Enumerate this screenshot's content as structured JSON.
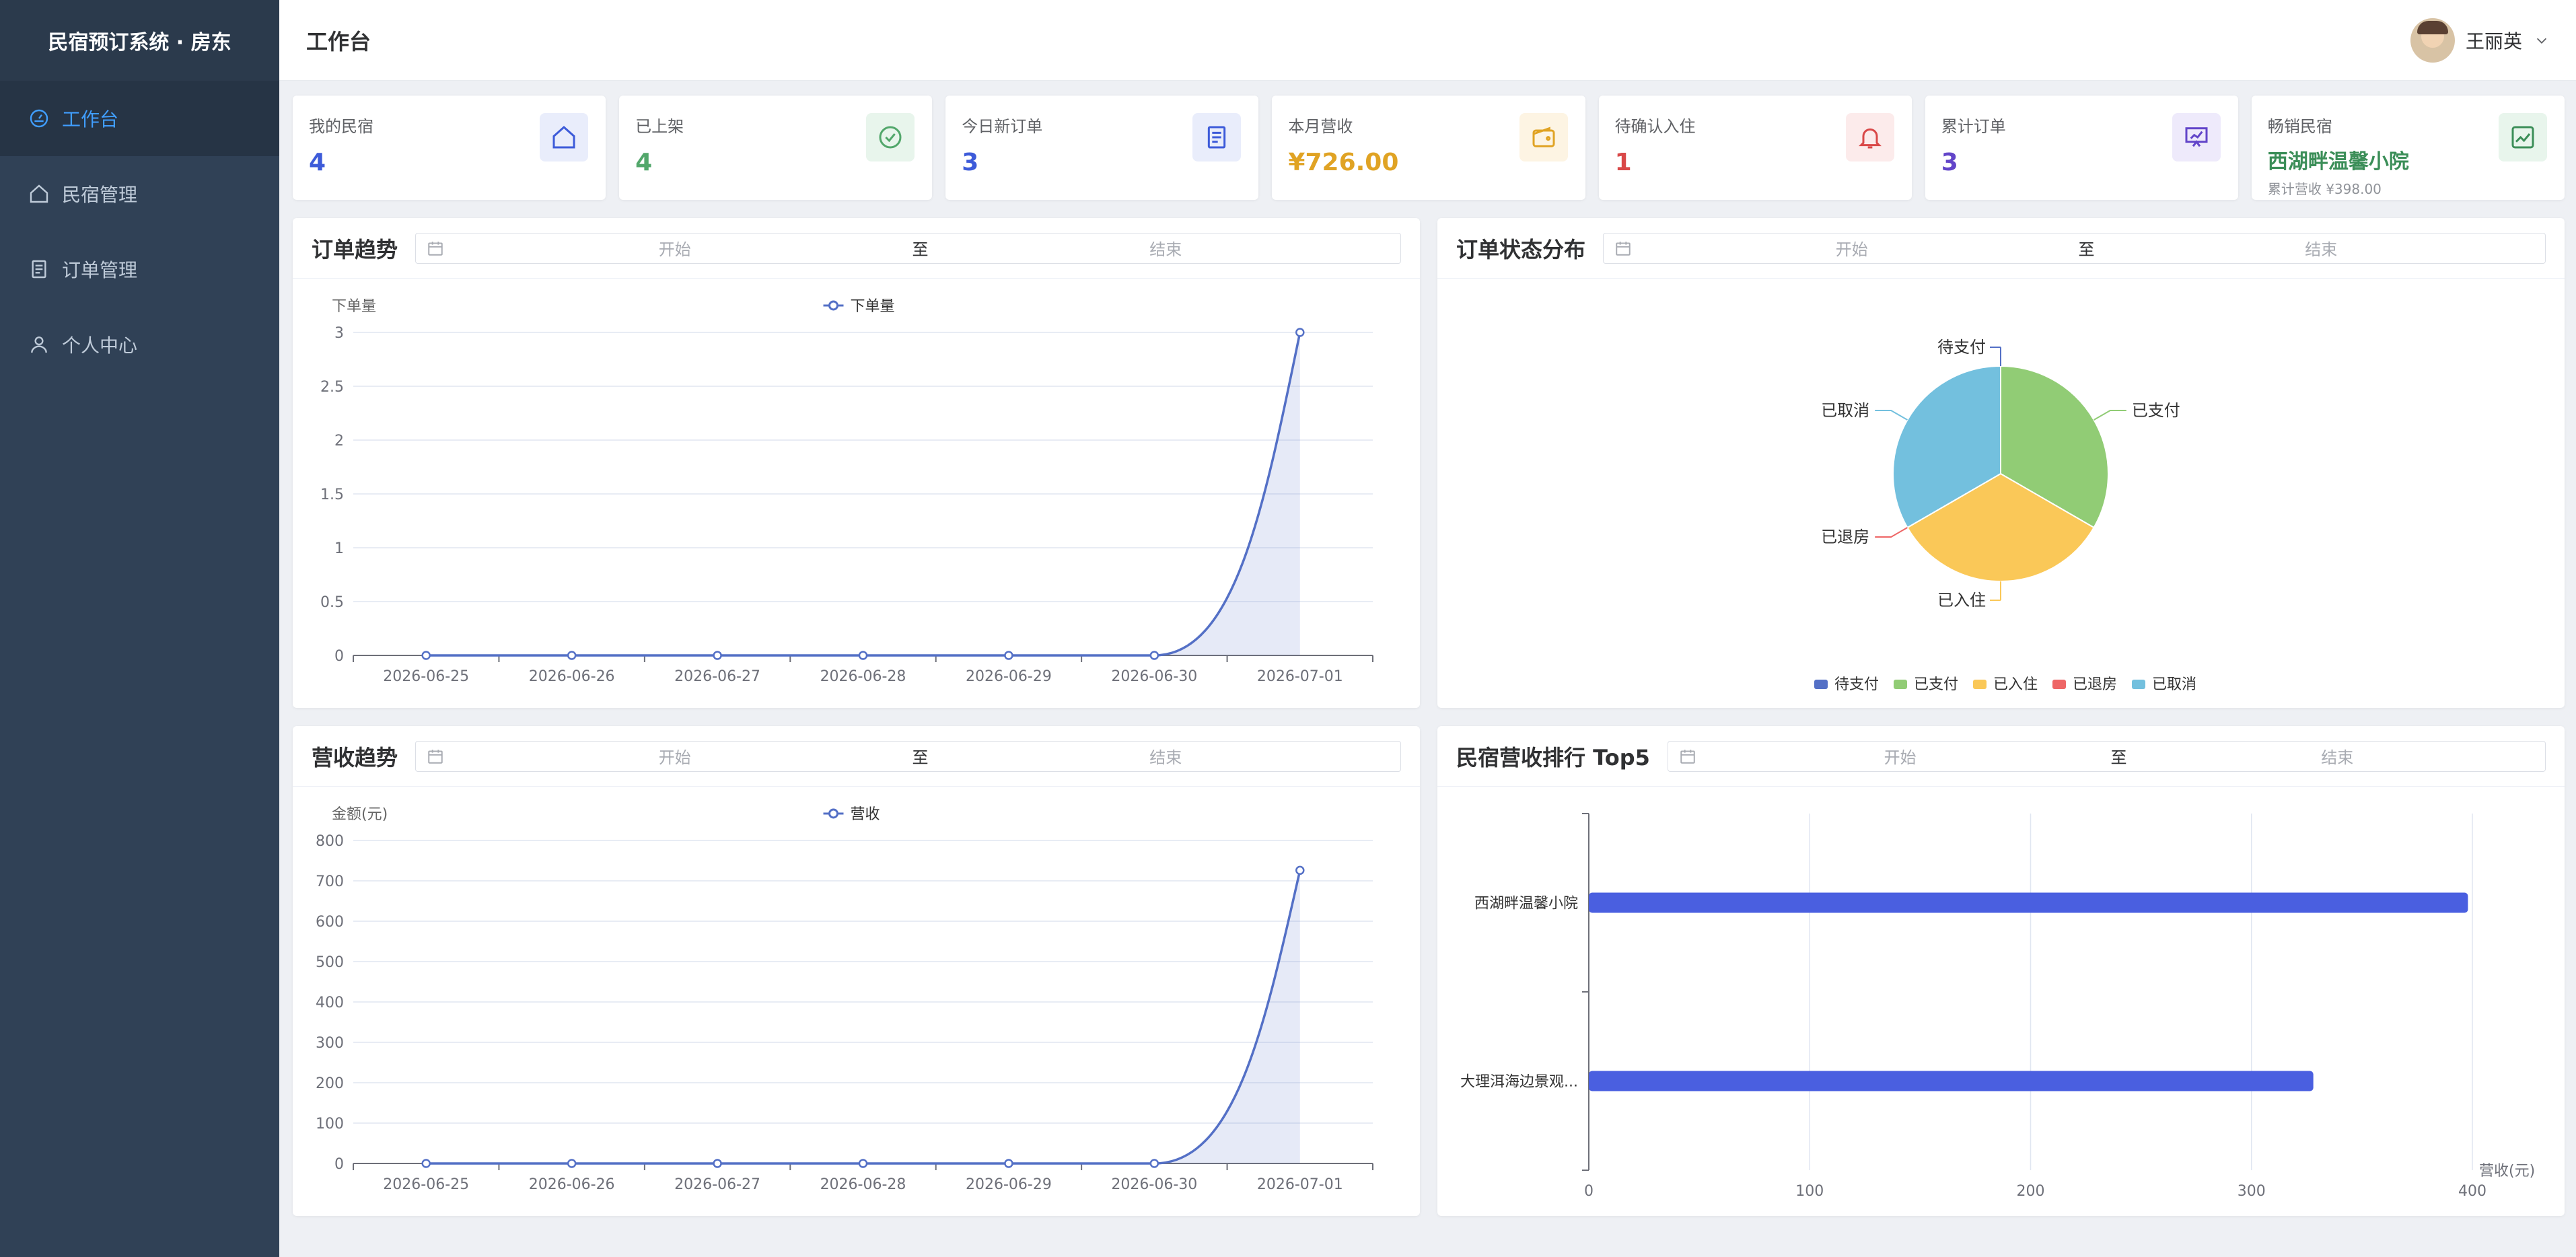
{
  "app": {
    "title": "民宿预订系统 · 房东"
  },
  "sidebar": {
    "items": [
      {
        "label": "工作台",
        "icon": "dashboard-icon"
      },
      {
        "label": "民宿管理",
        "icon": "home-icon"
      },
      {
        "label": "订单管理",
        "icon": "document-icon"
      },
      {
        "label": "个人中心",
        "icon": "user-icon"
      }
    ]
  },
  "header": {
    "title": "工作台",
    "username": "王丽英"
  },
  "stats": [
    {
      "label": "我的民宿",
      "value": "4",
      "color": "#3d5bd9",
      "icon": "home-icon",
      "iconBg": "#e9edfb"
    },
    {
      "label": "已上架",
      "value": "4",
      "color": "#52a76b",
      "icon": "check-circle-icon",
      "iconBg": "#e8f5ec"
    },
    {
      "label": "今日新订单",
      "value": "3",
      "color": "#3d5bd9",
      "icon": "document-icon",
      "iconBg": "#e9edfb"
    },
    {
      "label": "本月营收",
      "value": "¥726.00",
      "color": "#e0a324",
      "icon": "wallet-icon",
      "iconBg": "#fdf4e3"
    },
    {
      "label": "待确认入住",
      "value": "1",
      "color": "#d94848",
      "icon": "bell-icon",
      "iconBg": "#fcebeb"
    },
    {
      "label": "累计订单",
      "value": "3",
      "color": "#6245c9",
      "icon": "presentation-icon",
      "iconBg": "#eeeafb"
    },
    {
      "label": "畅销民宿",
      "value": "西湖畔温馨小院",
      "sub": "累计营收 ¥398.00",
      "color": "#3b8e58",
      "icon": "trend-icon",
      "iconBg": "#e8f5ec"
    }
  ],
  "range": {
    "start": "开始",
    "sep": "至",
    "end": "结束"
  },
  "panels": {
    "orderTrend": "订单趋势",
    "statusDist": "订单状态分布",
    "revenueTrend": "营收趋势",
    "top5": "民宿营收排行 Top5"
  },
  "chart_data": [
    {
      "type": "line",
      "title": "",
      "ylabel": "下单量",
      "legend": "下单量",
      "categories": [
        "2026-06-25",
        "2026-06-26",
        "2026-06-27",
        "2026-06-28",
        "2026-06-29",
        "2026-06-30",
        "2026-07-01"
      ],
      "series": [
        {
          "name": "下单量",
          "values": [
            0,
            0,
            0,
            0,
            0,
            0,
            3
          ]
        }
      ],
      "yticks": [
        0,
        0.5,
        1,
        1.5,
        2,
        2.5,
        3
      ],
      "ylim": [
        0,
        3
      ],
      "smooth": true,
      "area": true,
      "color": "#5470c6"
    },
    {
      "type": "pie",
      "legend": [
        "待支付",
        "已支付",
        "已入住",
        "已退房",
        "已取消"
      ],
      "colors": [
        "#5470c6",
        "#91cc75",
        "#fac858",
        "#ee6666",
        "#73c0de"
      ],
      "values": [
        0,
        1,
        1,
        0,
        1
      ]
    },
    {
      "type": "line",
      "title": "",
      "ylabel": "金额(元)",
      "legend": "营收",
      "categories": [
        "2026-06-25",
        "2026-06-26",
        "2026-06-27",
        "2026-06-28",
        "2026-06-29",
        "2026-06-30",
        "2026-07-01"
      ],
      "series": [
        {
          "name": "营收",
          "values": [
            0,
            0,
            0,
            0,
            0,
            0,
            726
          ]
        }
      ],
      "yticks": [
        0,
        100,
        200,
        300,
        400,
        500,
        600,
        700,
        800
      ],
      "ylim": [
        0,
        800
      ],
      "smooth": true,
      "area": true,
      "color": "#5470c6"
    },
    {
      "type": "bar",
      "orientation": "horizontal",
      "xlabel": "营收(元)",
      "categories": [
        "西湖畔温馨小院",
        "大理洱海边景观..."
      ],
      "values": [
        398,
        328
      ],
      "xticks": [
        0,
        100,
        200,
        300,
        400
      ],
      "xlim": [
        0,
        400
      ],
      "color": "#4a5fe0"
    }
  ]
}
